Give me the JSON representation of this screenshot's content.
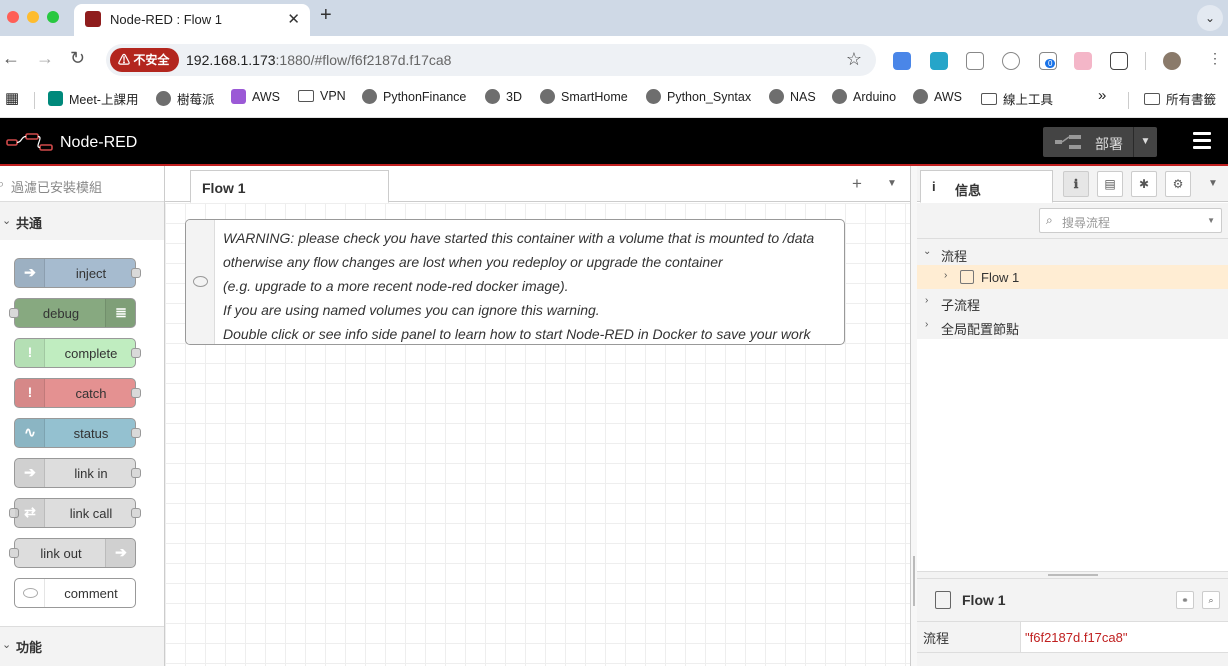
{
  "browser": {
    "tab_title": "Node-RED : Flow 1",
    "tab_close": "✕",
    "new_tab": "+",
    "tab_menu": "⌄",
    "nav": {
      "back": "←",
      "forward": "→",
      "reload": "↻"
    },
    "security_label": "不安全",
    "url_host": "192.168.1.173",
    "url_rest": ":1880/#flow/f6f2187d.f17ca8",
    "bookmark_star": "☆",
    "extension_badge": "0",
    "bookmarks": [
      {
        "label": "Meet-上課用",
        "icon": "meet-icon"
      },
      {
        "label": "樹莓派",
        "icon": "github-icon"
      },
      {
        "label": "AWS",
        "icon": "aws-cube-icon"
      },
      {
        "label": "VPN",
        "icon": "folder-icon"
      },
      {
        "label": "PythonFinance",
        "icon": "github-icon"
      },
      {
        "label": "3D",
        "icon": "github-icon"
      },
      {
        "label": "SmartHome",
        "icon": "github-icon"
      },
      {
        "label": "Python_Syntax",
        "icon": "github-icon"
      },
      {
        "label": "NAS",
        "icon": "github-icon"
      },
      {
        "label": "Arduino",
        "icon": "github-icon"
      },
      {
        "label": "AWS",
        "icon": "github-icon"
      },
      {
        "label": "線上工具",
        "icon": "folder-icon"
      }
    ],
    "bookmarks_more": "»",
    "all_bookmarks": "所有書籤"
  },
  "header": {
    "app_title": "Node-RED",
    "deploy_label": "部署",
    "deploy_caret": "▼"
  },
  "palette": {
    "filter_placeholder": "過濾已安裝模組",
    "category_common": "共通",
    "category_function": "功能",
    "nodes": [
      {
        "label": "inject",
        "color": "#a6bbcf",
        "glyph": "➔"
      },
      {
        "label": "debug",
        "color": "#87a980",
        "glyph": "≣"
      },
      {
        "label": "complete",
        "color": "#c0edc0",
        "glyph": "!"
      },
      {
        "label": "catch",
        "color": "#e49191",
        "glyph": "!"
      },
      {
        "label": "status",
        "color": "#94c1d0",
        "glyph": "∿"
      },
      {
        "label": "link in",
        "color": "#dddddd",
        "glyph": "➔"
      },
      {
        "label": "link call",
        "color": "#dddddd",
        "glyph": "⇄"
      },
      {
        "label": "link out",
        "color": "#dddddd",
        "glyph": "➔"
      },
      {
        "label": "comment",
        "color": "#ffffff",
        "glyph": "💬"
      }
    ]
  },
  "workspace": {
    "tab_label": "Flow 1",
    "add_tab": "+",
    "tab_menu": "▼",
    "comment_lines": [
      "WARNING: please check you have started this container with a volume that is mounted to /data",
      "otherwise any flow changes are lost when you redeploy or upgrade the container",
      "(e.g. upgrade to a more recent node-red docker image).",
      "If you are using named volumes you can ignore this warning.",
      "Double click or see info side panel to learn how to start Node-RED in Docker to save your work"
    ]
  },
  "sidebar": {
    "tab_icon": "i",
    "tab_label": "信息",
    "menu": "▼",
    "search_placeholder": "搜尋流程",
    "tree": {
      "flows_label": "流程",
      "flow_item": "Flow 1",
      "subflows_label": "子流程",
      "global_config_label": "全局配置節點"
    },
    "props": {
      "title": "Flow 1",
      "key": "流程",
      "value": "\"f6f2187d.f17ca8\""
    }
  }
}
